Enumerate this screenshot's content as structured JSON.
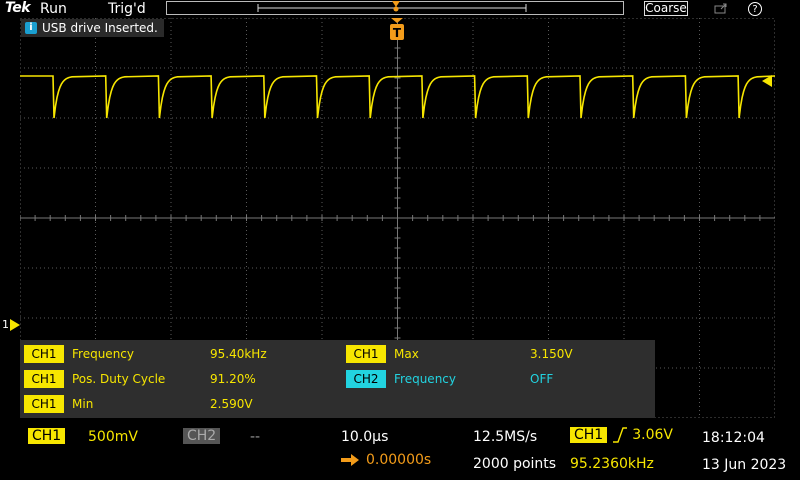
{
  "topbar": {
    "brand": "Tek",
    "run_state": "Run",
    "trig_state": "Trig'd",
    "coarse_label": "Coarse",
    "help_label": "?"
  },
  "notice": {
    "icon_label": "i",
    "text": "USB drive Inserted."
  },
  "trigger_marker": "T",
  "channel_marker": "1",
  "measurements": [
    {
      "channel": "CH1",
      "name": "Frequency",
      "value": "95.40kHz",
      "color": "#f7e600"
    },
    {
      "channel": "CH1",
      "name": "Pos. Duty Cycle",
      "value": "91.20%",
      "color": "#f7e600"
    },
    {
      "channel": "CH1",
      "name": "Min",
      "value": "2.590V",
      "color": "#f7e600"
    },
    {
      "channel": "CH1",
      "name": "Max",
      "value": "3.150V",
      "color": "#f7e600"
    },
    {
      "channel": "CH2",
      "name": "Frequency",
      "value": "OFF",
      "color": "#22d3e0"
    }
  ],
  "status": {
    "ch1_label": "CH1",
    "ch1_scale": "500mV",
    "ch2_label": "CH2",
    "ch2_scale": "--",
    "time_div": "10.0µs",
    "sample_rate": "12.5MS/s",
    "record_length": "2000 points",
    "trigger_source": "CH1",
    "trigger_level": "3.06V",
    "trigger_position": "0.00000s",
    "trigger_frequency": "95.2360kHz",
    "time": "18:12:04",
    "date": "13 Jun 2023"
  },
  "colors": {
    "ch1": "#f7e600",
    "ch2": "#22d3e0",
    "trigger": "#f39c1a",
    "grid": "#5a5a5a"
  }
}
